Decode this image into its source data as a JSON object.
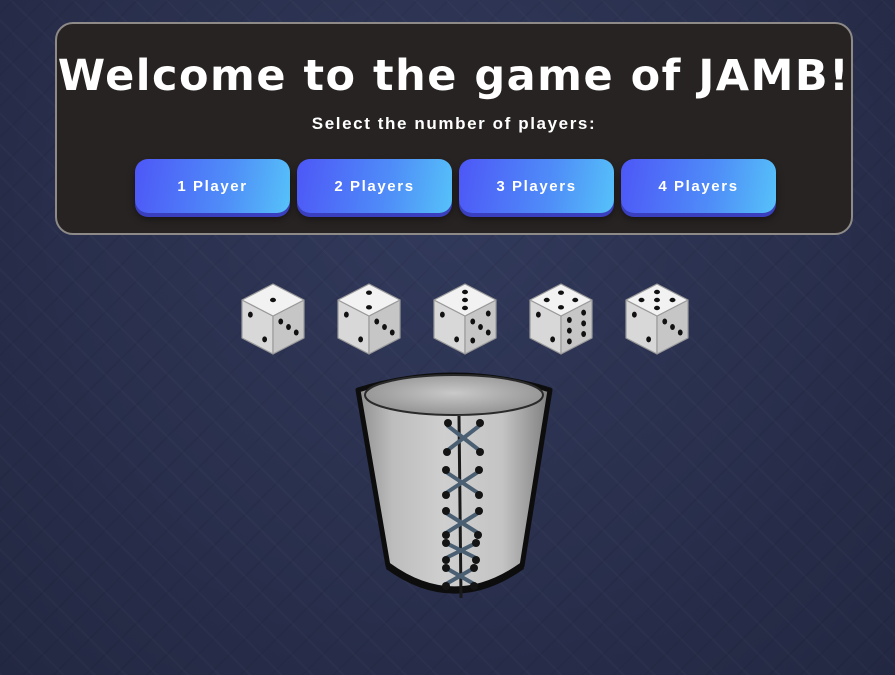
{
  "welcome": {
    "title": "Welcome to the game of JAMB!",
    "subtitle": "Select the number of players:"
  },
  "player_buttons": [
    {
      "label": "1 Player",
      "players": 1
    },
    {
      "label": "2 Players",
      "players": 2
    },
    {
      "label": "3 Players",
      "players": 3
    },
    {
      "label": "4 Players",
      "players": 4
    }
  ],
  "dice": [
    {
      "top_face": 1,
      "left_face": 2,
      "right_face": 3
    },
    {
      "top_face": 2,
      "left_face": 2,
      "right_face": 3
    },
    {
      "top_face": 3,
      "left_face": 2,
      "right_face": 5
    },
    {
      "top_face": 4,
      "left_face": 2,
      "right_face": 6
    },
    {
      "top_face": 5,
      "left_face": 2,
      "right_face": 3
    }
  ],
  "dice_cup": {
    "icon": "dice-cup-icon"
  },
  "colors": {
    "background": "#2a3150",
    "panel": "#272322",
    "button_start": "#4d57f7",
    "button_end": "#56c2f9"
  }
}
